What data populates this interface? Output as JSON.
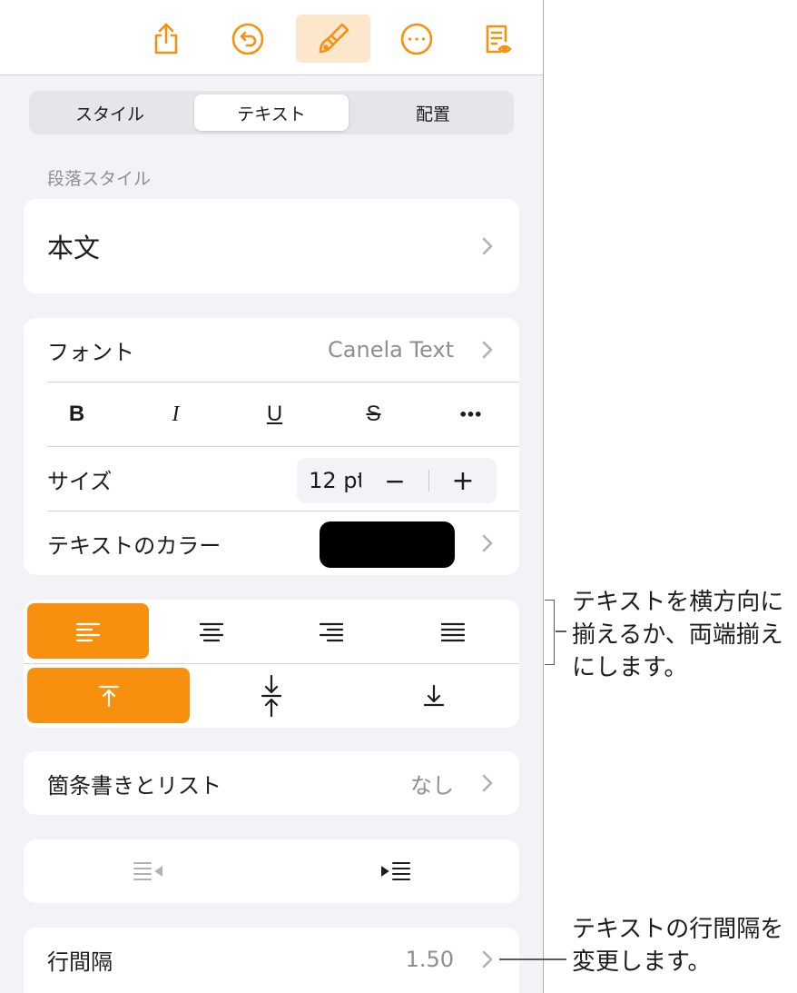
{
  "toolbar": {
    "buttons": [
      {
        "icon": "share-icon"
      },
      {
        "icon": "undo-icon"
      },
      {
        "icon": "format-brush-icon",
        "active": true
      },
      {
        "icon": "more-icon"
      },
      {
        "icon": "document-view-icon"
      }
    ],
    "accent_color": "#f7900f"
  },
  "segments": [
    "スタイル",
    "テキスト",
    "配置"
  ],
  "selected_segment": "テキスト",
  "paragraph_style": {
    "section_label": "段落スタイル",
    "value": "本文"
  },
  "font": {
    "label": "フォント",
    "value": "Canela Text",
    "style_buttons": [
      "B",
      "I",
      "U",
      "S",
      "•••"
    ]
  },
  "size": {
    "label": "サイズ",
    "value": "12 pt",
    "decrement": "−",
    "increment": "+"
  },
  "text_color": {
    "label": "テキストのカラー",
    "swatch": "#000000"
  },
  "alignment": {
    "horizontal": [
      "align-left-icon",
      "align-center-icon",
      "align-right-icon",
      "justify-icon"
    ],
    "horizontal_selected": "align-left-icon",
    "vertical": [
      "align-top-icon",
      "align-middle-icon",
      "align-bottom-icon"
    ],
    "vertical_selected": "align-top-icon"
  },
  "bullets": {
    "label": "箇条書きとリスト",
    "value": "なし"
  },
  "indent": {
    "buttons": [
      "decrease-indent-icon",
      "increase-indent-icon"
    ]
  },
  "line_spacing": {
    "label": "行間隔",
    "value": "1.50"
  },
  "callouts": {
    "alignment": "テキストを横方向に\n揃えるか、両端揃え\nにします。",
    "line_spacing": "テキストの行間隔を\n変更します。"
  }
}
